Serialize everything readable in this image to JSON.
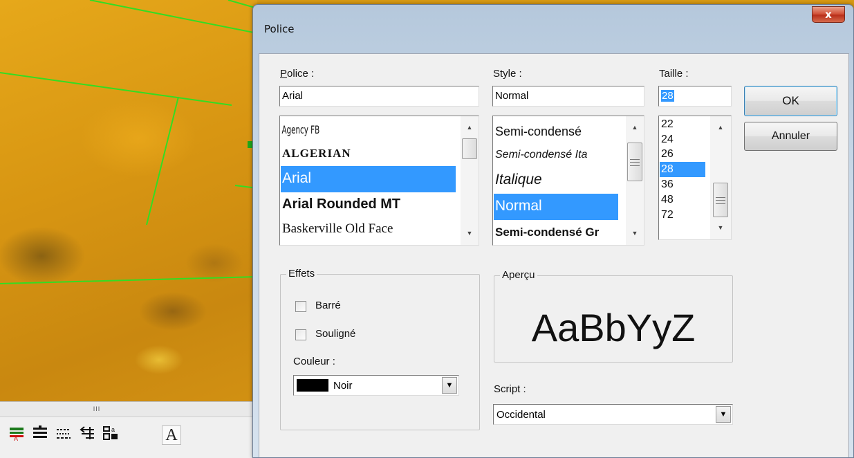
{
  "map": {
    "scroll_grip": "III",
    "toolbar": [
      {
        "name": "layer-color-icon",
        "glyph": "▬"
      },
      {
        "name": "align-lines-icon",
        "glyph": "≣"
      },
      {
        "name": "dashed-lines-icon",
        "glyph": "☷"
      },
      {
        "name": "arrow-lines-icon",
        "glyph": "⇇"
      },
      {
        "name": "grid-label-icon",
        "glyph": "▦"
      },
      {
        "name": "font-icon",
        "glyph": "A"
      }
    ]
  },
  "dialog": {
    "title": "Police",
    "close_label": "x",
    "font_label": "Police :",
    "font_value": "Arial",
    "font_list": [
      "Agency FB",
      "ALGERIAN",
      "Arial",
      "Arial Rounded MT",
      "Baskerville Old Face"
    ],
    "style_label": "Style :",
    "style_value": "Normal",
    "style_list": [
      "Semi-condensé",
      "Semi-condensé Ita",
      "Italique",
      "Normal",
      "Semi-condensé Gr"
    ],
    "size_label": "Taille :",
    "size_value": "28",
    "size_list": [
      "22",
      "24",
      "26",
      "28",
      "36",
      "48",
      "72"
    ],
    "ok_label": "OK",
    "cancel_label": "Annuler",
    "effects_label": "Effets",
    "strike_label": "Barré",
    "underline_label": "Souligné",
    "color_label": "Couleur :",
    "color_value": "Noir",
    "color_swatch": "#000000",
    "preview_label": "Aperçu",
    "preview_text": "AaBbYyZ",
    "script_label": "Script :",
    "script_value": "Occidental",
    "selection_color": "#3399ff"
  }
}
